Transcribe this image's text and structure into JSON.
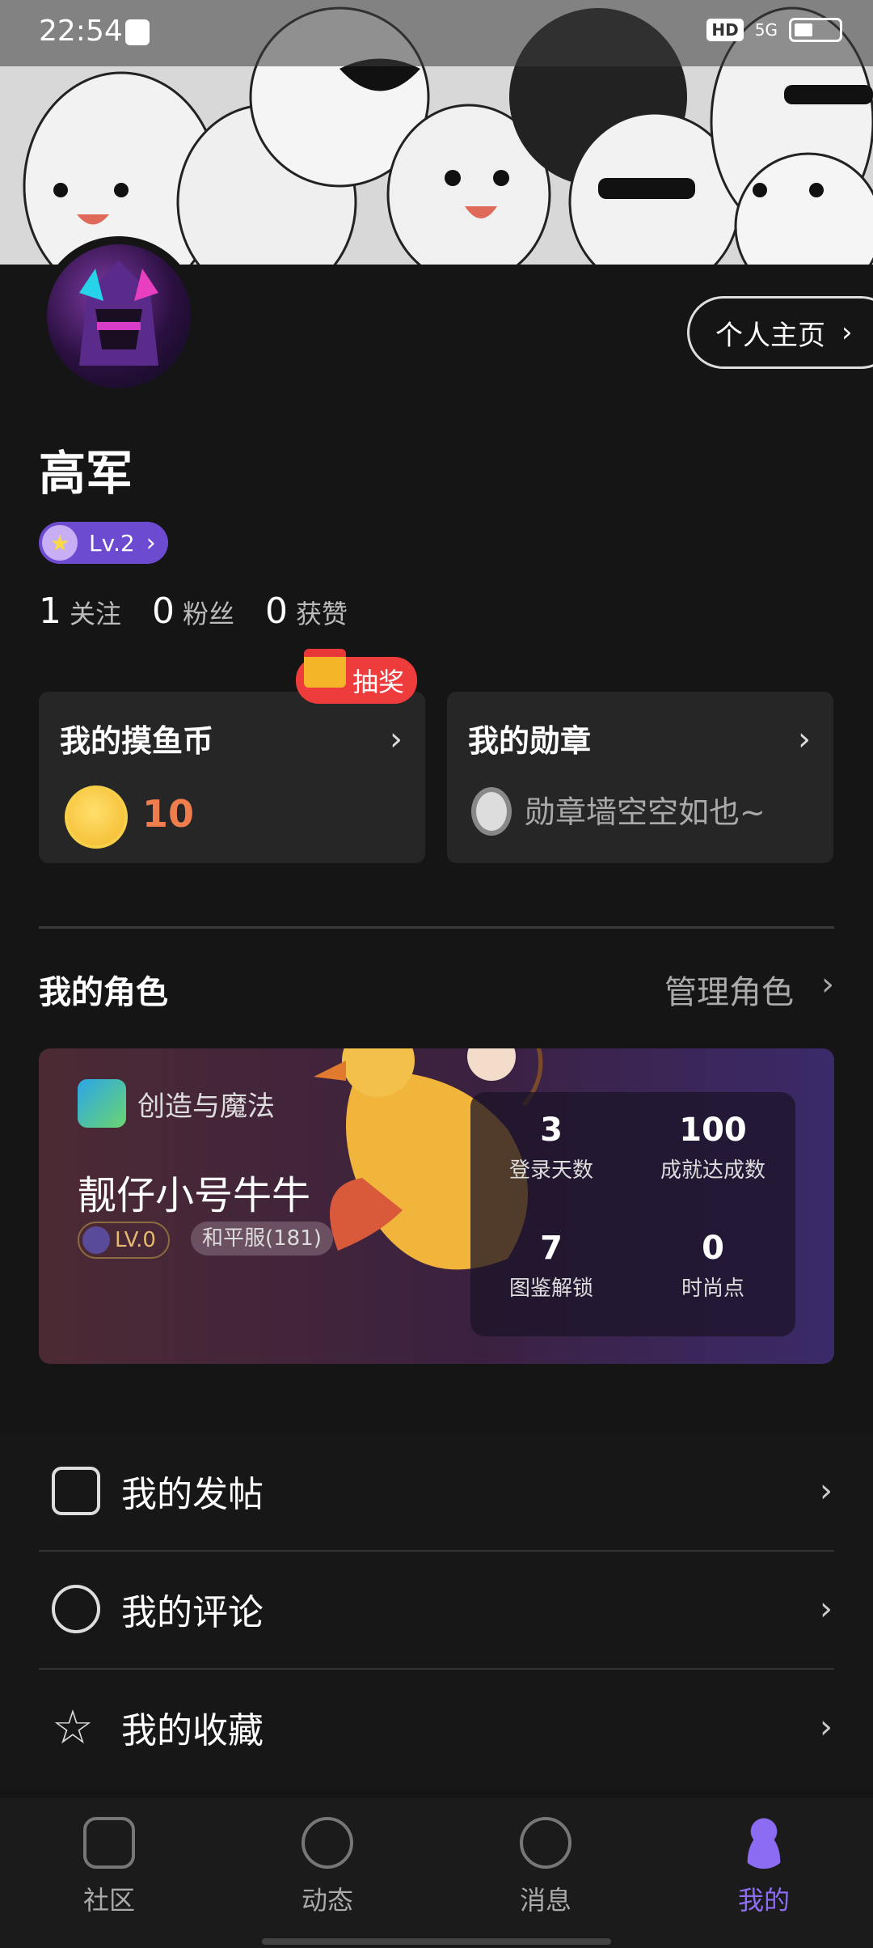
{
  "status_bar": {
    "time": "22:54",
    "hd": "HD",
    "network": "5G"
  },
  "profile": {
    "homepage_button": "个人主页",
    "username": "高军",
    "level": "Lv.2",
    "stats": [
      {
        "value": "1",
        "label": "关注"
      },
      {
        "value": "0",
        "label": "粉丝"
      },
      {
        "value": "0",
        "label": "获赞"
      }
    ]
  },
  "cards": {
    "lottery_badge": "抽奖",
    "coins": {
      "title": "我的摸鱼币",
      "value": "10"
    },
    "medals": {
      "title": "我的勋章",
      "empty_text": "勋章墙空空如也~"
    }
  },
  "roles": {
    "title": "我的角色",
    "manage": "管理角色",
    "card": {
      "game": "创造与魔法",
      "name": "靓仔小号牛牛",
      "level": "LV.0",
      "server": "和平服(181)",
      "stats": [
        {
          "num": "3",
          "label": "登录天数"
        },
        {
          "num": "100",
          "label": "成就达成数"
        },
        {
          "num": "7",
          "label": "图鉴解锁"
        },
        {
          "num": "0",
          "label": "时尚点"
        }
      ]
    }
  },
  "menu": [
    {
      "label": "我的发帖"
    },
    {
      "label": "我的评论"
    },
    {
      "label": "我的收藏"
    }
  ],
  "bottom_nav": [
    {
      "label": "社区"
    },
    {
      "label": "动态"
    },
    {
      "label": "消息"
    },
    {
      "label": "我的"
    }
  ],
  "colors": {
    "accent": "#8c6cf2",
    "coin_value": "#f07d4e",
    "lottery": "#ee3b3b"
  }
}
